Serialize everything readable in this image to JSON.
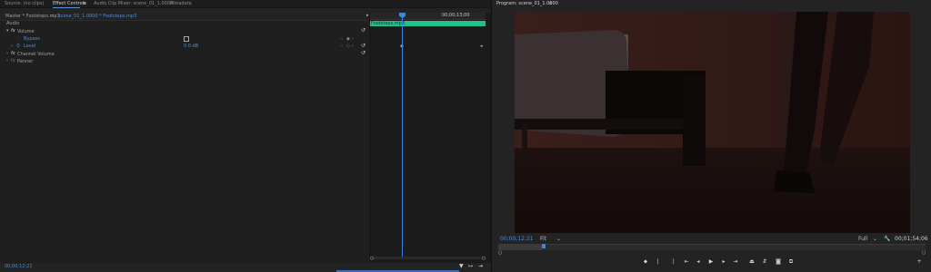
{
  "tabs": {
    "source": "Source: (no clips)",
    "effect_controls": "Effect Controls",
    "mixer": "Audio Clip Mixer: scene_01_1.0000",
    "metadata": "Metadata",
    "program": "Program: scene_01_1.0000"
  },
  "effect_controls": {
    "breadcrumb_master": "Master * Footsteps.mp3",
    "breadcrumb_clip": "scene_01_1.0000 * Footsteps.mp3",
    "section": "Audio",
    "volume": "Volume",
    "bypass": "Bypass",
    "level": "Level",
    "level_value": "0.0 dB",
    "channel_volume": "Channel Volume",
    "panner": "Panner",
    "timeline_time": "00;00;13;00",
    "clip_name": "Footsteps.mp3",
    "current_time": "00;00;12;21"
  },
  "program": {
    "timecode": "00;00;12;21",
    "fit": "Fit",
    "quality": "Full",
    "duration": "00;01;54;06"
  },
  "icons": [
    "wrench-icon",
    "filter-icon",
    "export-icon",
    "marker-icon",
    "in-point-icon",
    "out-point-icon",
    "go-to-in-icon",
    "step-back-icon",
    "play-icon",
    "step-forward-icon",
    "go-to-out-icon",
    "lift-icon",
    "extract-icon",
    "camera-icon",
    "compare-icon",
    "add-icon"
  ]
}
